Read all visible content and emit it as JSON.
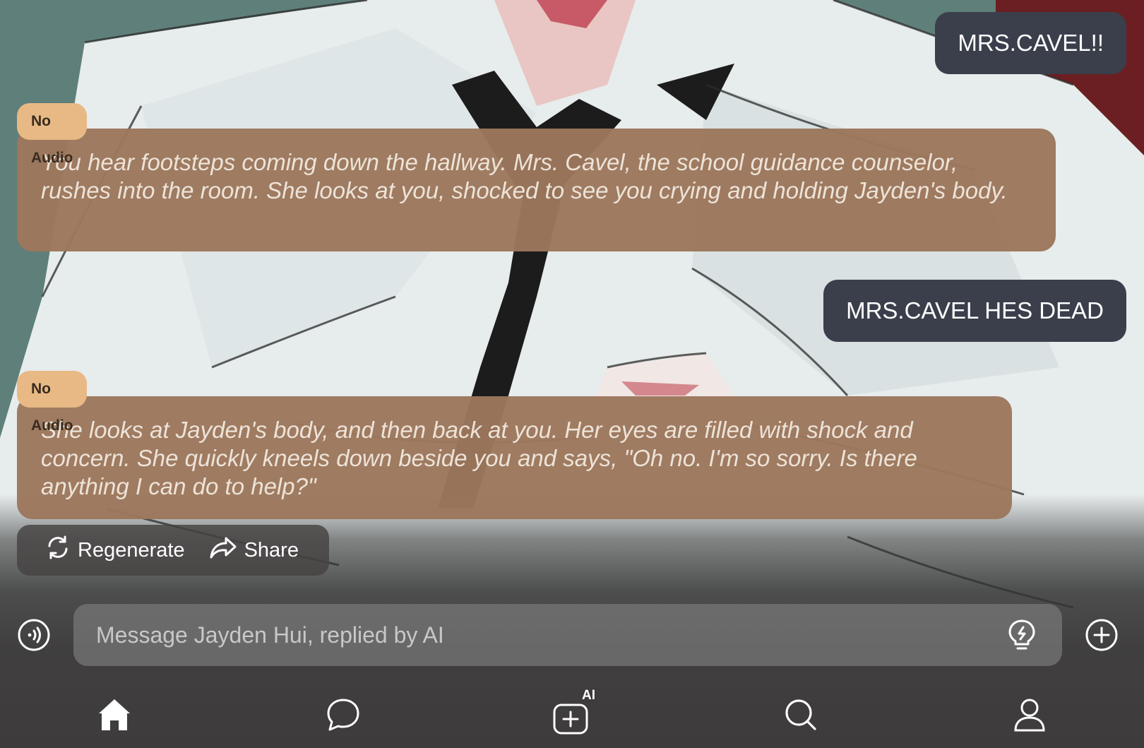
{
  "messages": {
    "user_1": "MRS.CAVEL!!",
    "ai_1": {
      "badge": "No Audio",
      "text": "You hear footsteps coming down the hallway. Mrs. Cavel, the school guidance counselor, rushes into the room. She looks at you, shocked to see you crying and holding Jayden's body."
    },
    "user_2": "MRS.CAVEL HES DEAD",
    "ai_2": {
      "badge": "No Audio",
      "text": "She looks at Jayden's body, and then back at you. Her eyes are filled with shock and concern. She quickly kneels down beside you and says, \"Oh no. I'm so sorry. Is there anything I can do to help?\""
    }
  },
  "actions": {
    "regenerate_label": "Regenerate",
    "share_label": "Share"
  },
  "composer": {
    "placeholder": "Message Jayden Hui, replied by AI",
    "value": ""
  },
  "nav": {
    "items": [
      "home-icon",
      "chat-icon",
      "create-ai-icon",
      "search-icon",
      "profile-icon"
    ],
    "create_badge": "AI"
  },
  "colors": {
    "user_bubble": "#3a3f4b",
    "ai_bubble": "#9c775c",
    "badge": "#e8b985",
    "background_teal": "#5f7f7a"
  }
}
